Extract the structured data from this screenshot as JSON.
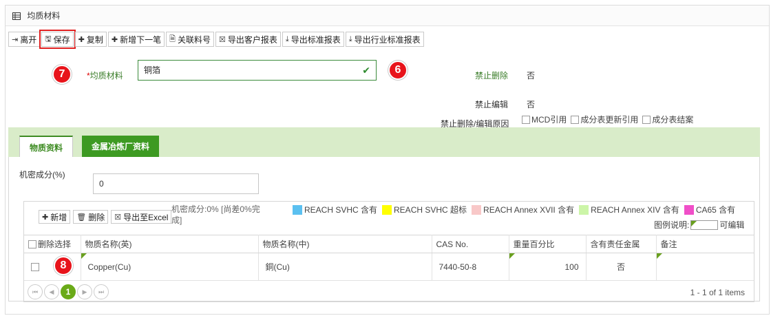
{
  "header": {
    "title": "均质材料",
    "icon": "grid-icon"
  },
  "toolbar": {
    "leave": "离开",
    "save": "保存",
    "copy": "复制",
    "add_next": "新增下一笔",
    "link_part": "关联料号",
    "export_customer": "导出客户报表",
    "export_standard": "导出标准报表",
    "export_industry": "导出行业标准报表"
  },
  "badges": {
    "save": "7",
    "material": "6",
    "row": "8"
  },
  "form": {
    "material_label": "均质材料",
    "required_mark": "*",
    "material_value": "铜箔",
    "no_delete_label": "禁止删除",
    "no_delete_value": "否",
    "no_edit_label": "禁止编辑",
    "no_edit_value": "否",
    "reason_label": "禁止删除/编辑原因",
    "reasons": [
      "MCD引用",
      "成分表更新引用",
      "成分表结案"
    ]
  },
  "tabs": {
    "substance": "物质资料",
    "smelter": "金属冶炼厂资料"
  },
  "secret": {
    "label": "机密成分(%)",
    "value": "0"
  },
  "grid_toolbar": {
    "add": "新增",
    "delete": "删除",
    "export_excel": "导出至Excel",
    "note": "机密成分:0% [尚差0%完成]"
  },
  "legend": {
    "items": [
      {
        "label": "REACH SVHC 含有",
        "color": "#5bc0f0"
      },
      {
        "label": "REACH SVHC 超标",
        "color": "#ffff00"
      },
      {
        "label": "REACH Annex XVII 含有",
        "color": "#f8c8c8"
      },
      {
        "label": "REACH Annex XIV 含有",
        "color": "#ccf5a8"
      },
      {
        "label": "CA65 含有",
        "color": "#f04fc8"
      }
    ],
    "explain_label": "图例说明:",
    "editable_label": "可编辑"
  },
  "table": {
    "headers": [
      "删除选择",
      "物质名称(英)",
      "物质名称(中)",
      "CAS No.",
      "重量百分比",
      "含有责任金属",
      "备注"
    ],
    "rows": [
      {
        "en": "Copper(Cu)",
        "cn": "銅(Cu)",
        "cas": "7440-50-8",
        "weight": "100",
        "metal": "否",
        "note": ""
      }
    ]
  },
  "pager": {
    "current": "1",
    "info": "1 - 1 of 1 items"
  },
  "colors": {
    "brand_green": "#3d9a22",
    "badge_red": "#e8141b"
  }
}
